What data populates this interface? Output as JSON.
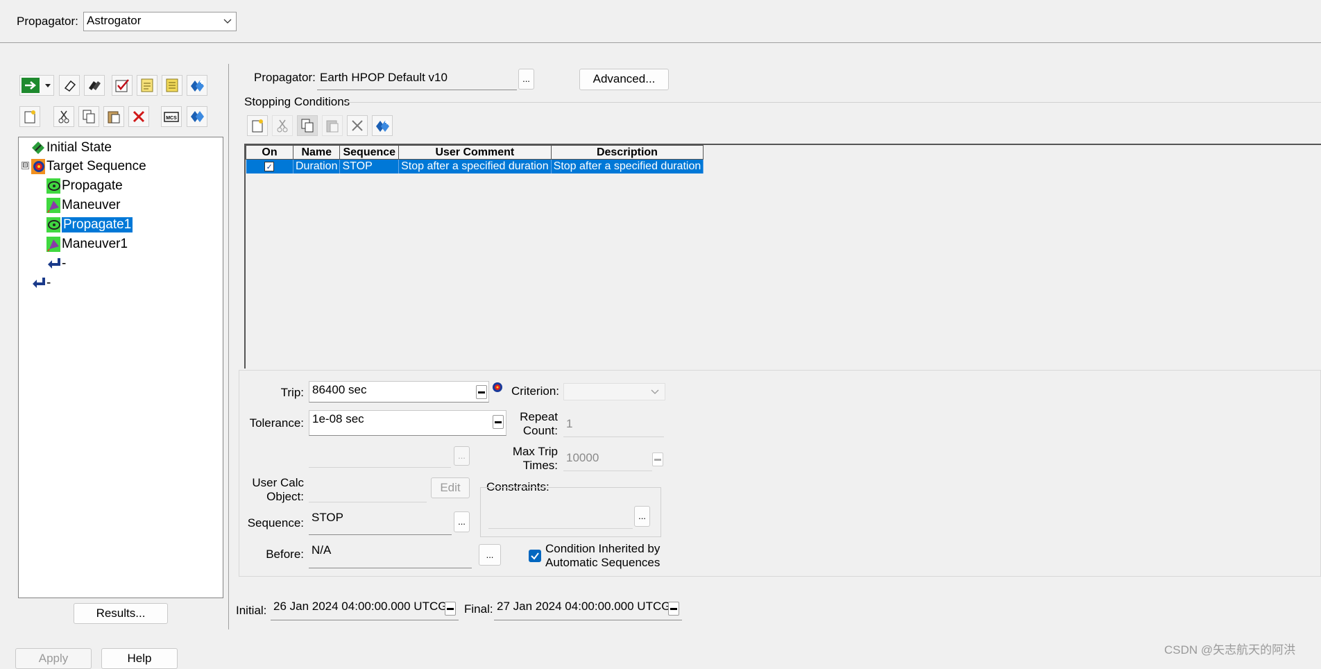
{
  "top": {
    "propagator_label": "Propagator:",
    "propagator_value": "Astrogator"
  },
  "toolbar_left_row1": [
    "run-icon",
    "dropdown-arrow-icon",
    "eraser-icon",
    "clear-all-icon",
    "check-icon",
    "notes-icon",
    "notes2-icon",
    "insert-icon"
  ],
  "toolbar_left_row2": [
    "new-icon",
    "cut-icon",
    "copy-icon",
    "paste-icon",
    "delete-icon",
    "mcs-icon",
    "component-icon"
  ],
  "tree": {
    "items": [
      {
        "label": "Initial State",
        "icon": "initial-state-icon"
      },
      {
        "label": "Target Sequence",
        "icon": "target-sequence-icon",
        "expander": "⊟"
      },
      {
        "label": "Propagate",
        "icon": "propagate-icon"
      },
      {
        "label": "Maneuver",
        "icon": "maneuver-icon"
      },
      {
        "label": "Propagate1",
        "icon": "propagate-icon",
        "selected": true
      },
      {
        "label": "Maneuver1",
        "icon": "maneuver-icon"
      },
      {
        "label": "-",
        "icon": "return-icon"
      },
      {
        "label": "-",
        "icon": "return-icon"
      }
    ]
  },
  "results_button": "Results...",
  "bottom_buttons": {
    "apply": "Apply",
    "help": "Help"
  },
  "right": {
    "propagator_label": "Propagator:",
    "propagator_value": "Earth HPOP Default v10",
    "ellipsis": "...",
    "advanced_button": "Advanced...",
    "stopping_conditions_label": "Stopping Conditions",
    "sc_toolbar": [
      "new-icon",
      "cut-icon",
      "copy-icon",
      "paste-icon",
      "delete-icon",
      "component-icon"
    ],
    "table": {
      "columns": [
        "On",
        "Name",
        "Sequence",
        "User Comment",
        "Description"
      ],
      "rows": [
        {
          "on": true,
          "name": "Duration",
          "sequence": "STOP",
          "comment": "Stop after a specified duration",
          "description": "Stop after a specified duration"
        }
      ]
    },
    "trip_label": "Trip:",
    "trip_value": "86400 sec",
    "criterion_label": "Criterion:",
    "tolerance_label": "Tolerance:",
    "tolerance_value": "1e-08 sec",
    "repeat_count_label": "Repeat Count:",
    "repeat_count_value": "1",
    "max_trip_times_label": "Max Trip Times:",
    "max_trip_times_value": "10000",
    "user_calc_label": "User Calc Object:",
    "edit_button": "Edit",
    "constraints_label": "Constraints:",
    "sequence_label": "Sequence:",
    "sequence_value": "STOP",
    "before_label": "Before:",
    "before_value": "N/A",
    "inherited_label": "Condition Inherited by Automatic Sequences",
    "initial_label": "Initial:",
    "initial_value": "26 Jan 2024 04:00:00.000 UTCG",
    "final_label": "Final:",
    "final_value": "27 Jan 2024 04:00:00.000 UTCG"
  },
  "watermark": "CSDN @矢志航天的阿洪"
}
